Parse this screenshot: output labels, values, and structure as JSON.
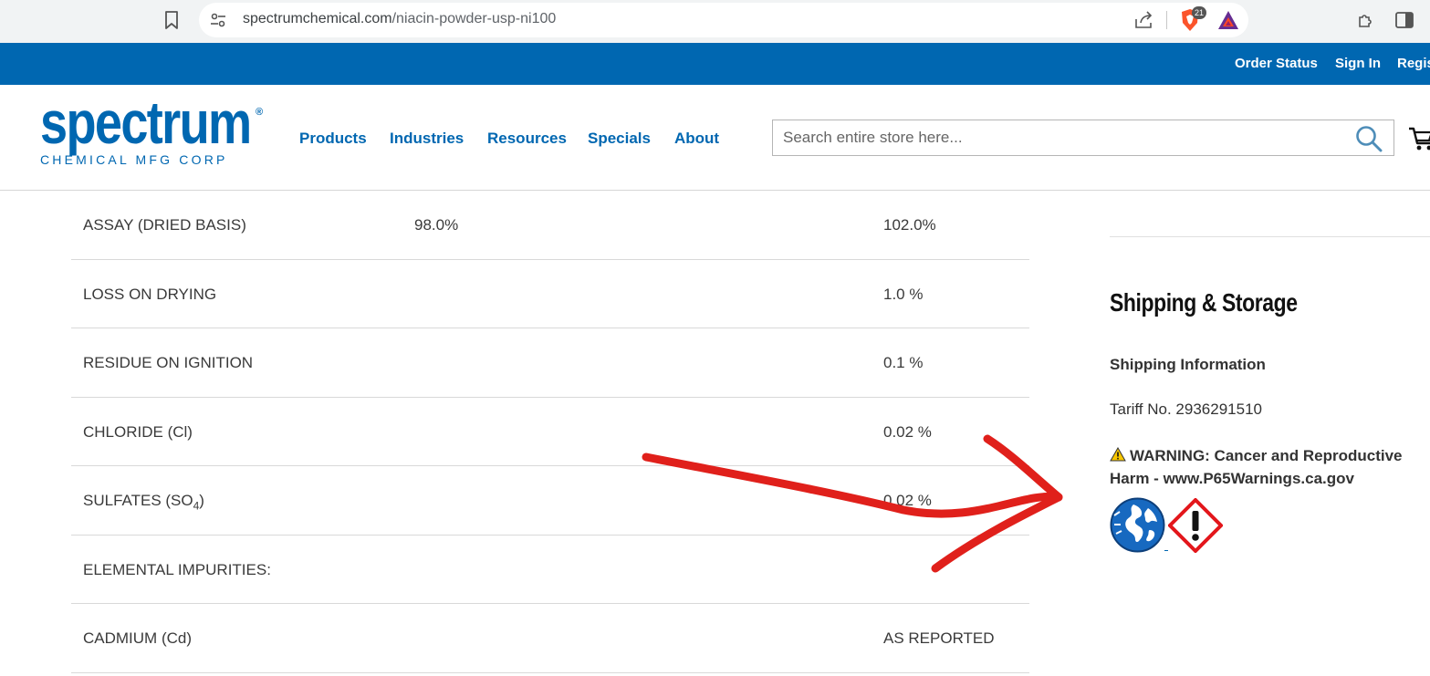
{
  "browser": {
    "url_domain": "spectrumchemical.com",
    "url_path": "/niacin-powder-usp-ni100",
    "brave_badge_count": "21"
  },
  "topbar": {
    "order_status": "Order Status",
    "sign_in": "Sign In",
    "register": "Regis"
  },
  "logo": {
    "word": "spectrum",
    "registered": "®",
    "sub": "CHEMICAL MFG CORP"
  },
  "nav": {
    "products": "Products",
    "industries": "Industries",
    "resources": "Resources",
    "specials": "Specials",
    "about": "About"
  },
  "search": {
    "placeholder": "Search entire store here..."
  },
  "spec_rows": [
    {
      "test": "ASSAY (DRIED BASIS)",
      "min": "98.0%",
      "max": "102.0%"
    },
    {
      "test": "LOSS ON DRYING",
      "min": "",
      "max": "1.0 %"
    },
    {
      "test": "RESIDUE ON IGNITION",
      "min": "",
      "max": "0.1 %"
    },
    {
      "test": "CHLORIDE (Cl)",
      "min": "",
      "max": "0.02 %"
    },
    {
      "test_prefix": "SULFATES (SO",
      "test_sub": "4",
      "test_suffix": ")",
      "min": "",
      "max": "0.02 %"
    },
    {
      "test": "ELEMENTAL IMPURITIES:",
      "min": "",
      "max": ""
    },
    {
      "test": "CADMIUM (Cd)",
      "min": "",
      "max": "AS REPORTED"
    }
  ],
  "shipping": {
    "title": "Shipping & Storage",
    "info_heading": "Shipping Information",
    "tariff": "Tariff No. 2936291510",
    "warning": "WARNING: Cancer and Reproductive Harm - www.P65Warnings.ca.gov"
  },
  "colors": {
    "brand_blue": "#0067b1",
    "annotation_red": "#e0201b",
    "ghs_red": "#e3161b"
  }
}
